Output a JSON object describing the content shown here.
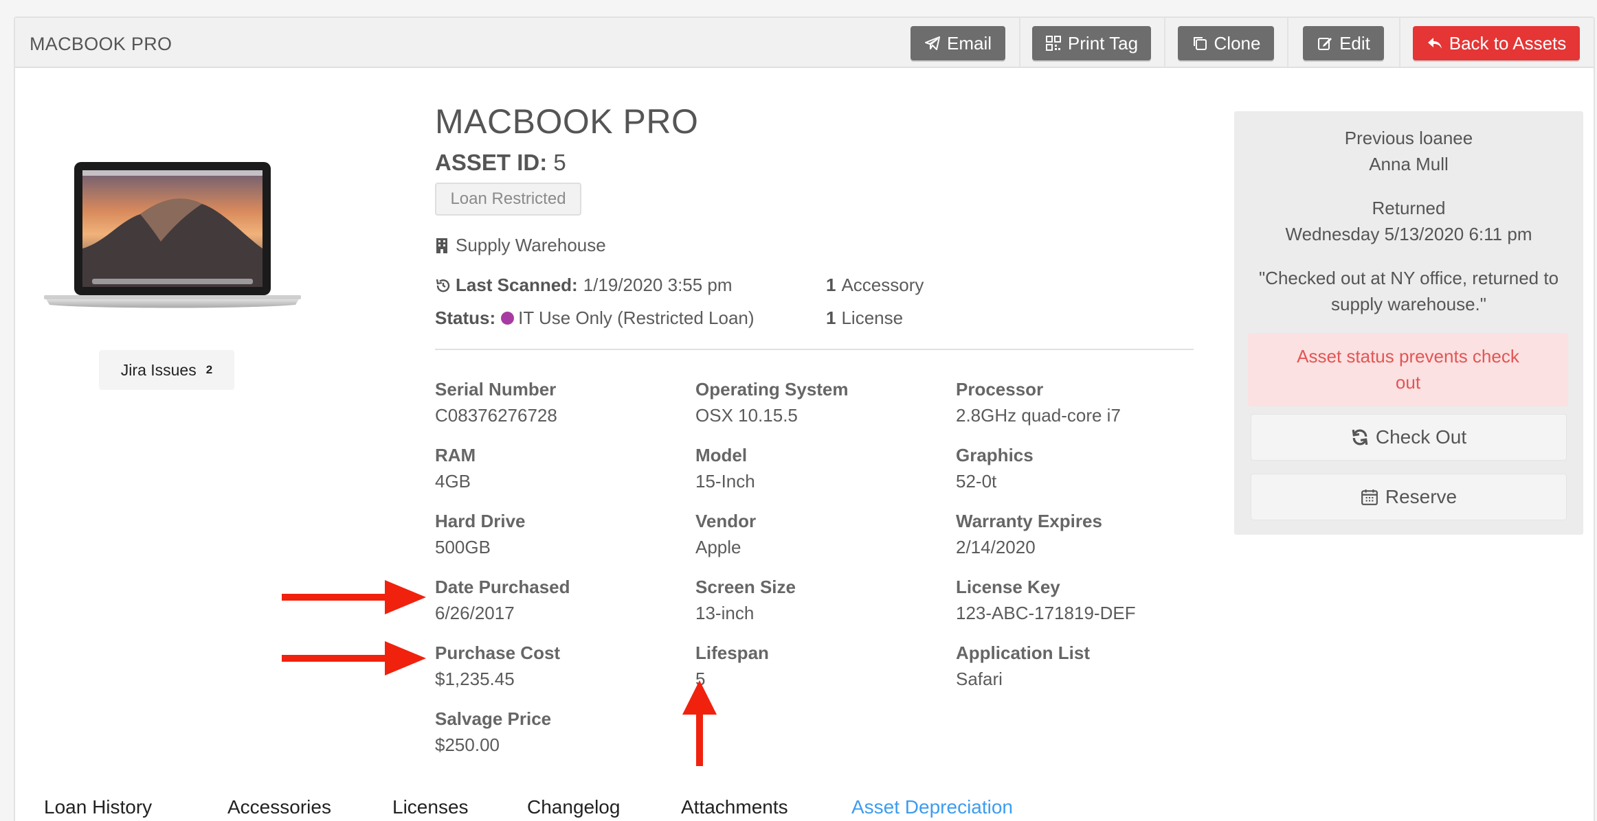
{
  "header": {
    "title": "MACBOOK PRO",
    "buttons": {
      "email": "Email",
      "print_tag": "Print Tag",
      "clone": "Clone",
      "edit": "Edit",
      "back": "Back to Assets"
    }
  },
  "image": {
    "alt_icon": "laptop-image"
  },
  "jira": {
    "label": "Jira Issues",
    "count": "2"
  },
  "asset": {
    "title": "MACBOOK PRO",
    "id_label": "ASSET ID:",
    "id_value": "5",
    "badge": "Loan Restricted",
    "location": "Supply Warehouse",
    "last_scanned_label": "Last Scanned:",
    "last_scanned_value": "1/19/2020 3:55 pm",
    "status_label": "Status:",
    "status_value": "IT Use Only (Restricted Loan)",
    "status_color": "#a73ba3",
    "accessory_count": "1",
    "accessory_label": "Accessory",
    "license_count": "1",
    "license_label": "License"
  },
  "fields": [
    {
      "label": "Serial Number",
      "value": "C08376276728"
    },
    {
      "label": "Operating System",
      "value": "OSX 10.15.5"
    },
    {
      "label": "Processor",
      "value": "2.8GHz quad-core i7"
    },
    {
      "label": "RAM",
      "value": "4GB"
    },
    {
      "label": "Model",
      "value": "15-Inch"
    },
    {
      "label": "Graphics",
      "value": "52-0t"
    },
    {
      "label": "Hard Drive",
      "value": "500GB"
    },
    {
      "label": "Vendor",
      "value": "Apple"
    },
    {
      "label": "Warranty Expires",
      "value": "2/14/2020"
    },
    {
      "label": "Date Purchased",
      "value": "6/26/2017"
    },
    {
      "label": "Screen Size",
      "value": "13-inch"
    },
    {
      "label": "License Key",
      "value": "123-ABC-171819-DEF"
    },
    {
      "label": "Purchase Cost",
      "value": "$1,235.45"
    },
    {
      "label": "Lifespan",
      "value": "5"
    },
    {
      "label": "Application List",
      "value": "Safari"
    },
    {
      "label": "Salvage Price",
      "value": "$250.00"
    }
  ],
  "side": {
    "prev_loanee_label": "Previous loanee",
    "prev_loanee_name": "Anna Mull",
    "returned_label": "Returned",
    "returned_date": "Wednesday 5/13/2020 6:11 pm",
    "note_line1": "\"Checked out at NY office, returned to",
    "note_line2": "supply warehouse.\"",
    "alert_line1": "Asset status prevents check",
    "alert_line2": "out",
    "checkout": "Check Out",
    "reserve": "Reserve"
  },
  "tabs": [
    {
      "label": "Loan History"
    },
    {
      "label": "Accessories"
    },
    {
      "label": "Licenses"
    },
    {
      "label": "Changelog"
    },
    {
      "label": "Attachments"
    },
    {
      "label": "Asset Depreciation",
      "active": true
    }
  ],
  "colors": {
    "accent": "#3d9cf0",
    "danger": "#e53535",
    "annotation_arrow": "#f0220e"
  }
}
